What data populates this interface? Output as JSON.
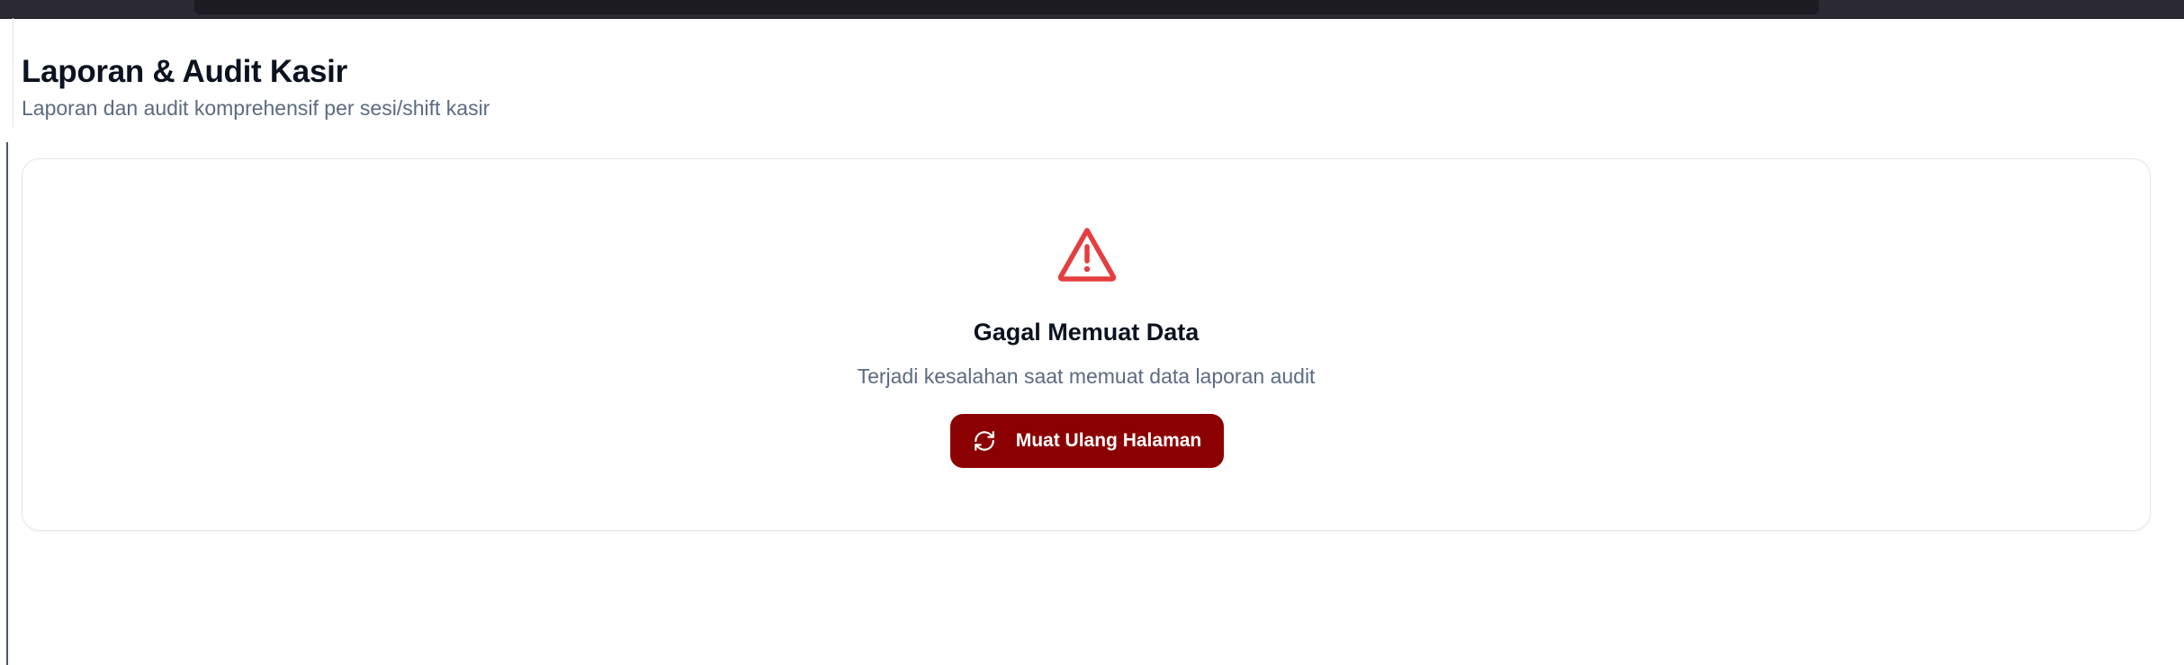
{
  "header": {
    "title": "Laporan & Audit Kasir",
    "subtitle": "Laporan dan audit komprehensif per sesi/shift kasir"
  },
  "error_state": {
    "icon": "alert-triangle-icon",
    "title": "Gagal Memuat Data",
    "message": "Terjadi kesalahan saat memuat data laporan audit",
    "reload_button": {
      "label": "Muat Ulang Halaman",
      "icon": "refresh-icon"
    }
  },
  "colors": {
    "accent": "#8b0000",
    "warning": "#e53e3e",
    "title_text": "#0b1220",
    "muted_text": "#5b6b82",
    "border": "#e5e7eb"
  }
}
